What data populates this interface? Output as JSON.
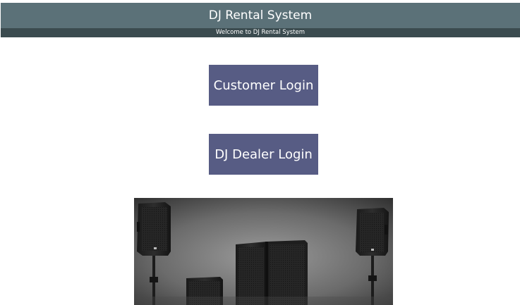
{
  "header": {
    "title": "DJ Rental System",
    "subtitle": "Welcome to DJ Rental System"
  },
  "main": {
    "customer_login_label": "Customer Login",
    "dealer_login_label": "DJ Dealer Login"
  },
  "hero_image": {
    "subject": "speakers-image"
  },
  "colors": {
    "header_bg": "#5b7178",
    "subbar_bg": "#3b4b4f",
    "button_bg": "#575c84",
    "button_text": "#ffffff"
  }
}
